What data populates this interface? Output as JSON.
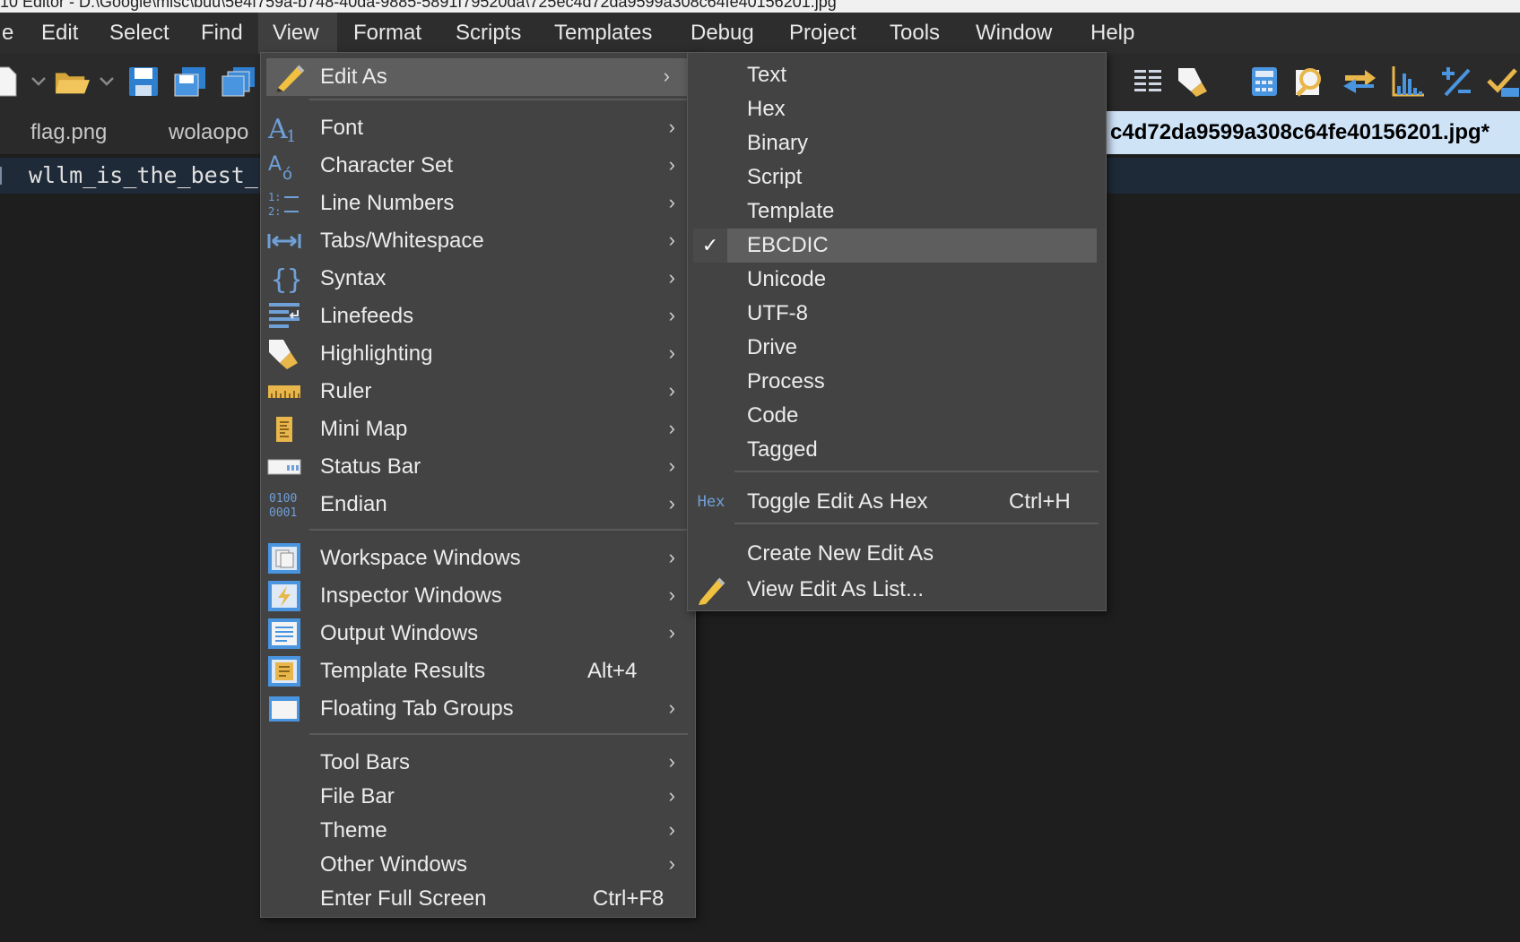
{
  "titlebar": {
    "text": "10 Editor - D:\\Google\\misc\\buu\\5e4f759a-b748-40da-9885-5891f79520da\\725ec4d72da9599a308c64fe40156201.jpg"
  },
  "menubar": {
    "items": [
      "e",
      "Edit",
      "Select",
      "Find",
      "View",
      "Format",
      "Scripts",
      "Templates",
      "Debug",
      "Project",
      "Tools",
      "Window",
      "Help"
    ]
  },
  "file_tabs": {
    "tab1": "flag.png",
    "tab2": "wolaopo",
    "active": "c4d72da9599a308c64fe40156201.jpg*"
  },
  "editor": {
    "line1": "wllm_is_the_best_"
  },
  "view_menu": {
    "edit_as": "Edit As",
    "font": "Font",
    "character_set": "Character Set",
    "line_numbers": "Line Numbers",
    "tabs_whitespace": "Tabs/Whitespace",
    "syntax": "Syntax",
    "linefeeds": "Linefeeds",
    "highlighting": "Highlighting",
    "ruler": "Ruler",
    "mini_map": "Mini Map",
    "status_bar": "Status Bar",
    "endian": "Endian",
    "workspace_windows": "Workspace Windows",
    "inspector_windows": "Inspector Windows",
    "output_windows": "Output Windows",
    "template_results": "Template Results",
    "template_results_shortcut": "Alt+4",
    "floating_tab_groups": "Floating Tab Groups",
    "tool_bars": "Tool Bars",
    "file_bar": "File Bar",
    "theme": "Theme",
    "other_windows": "Other Windows",
    "enter_full_screen": "Enter Full Screen",
    "enter_full_screen_shortcut": "Ctrl+F8",
    "arrow": "›"
  },
  "edit_as_menu": {
    "text": "Text",
    "hex": "Hex",
    "binary": "Binary",
    "script": "Script",
    "template": "Template",
    "ebcdic": "EBCDIC",
    "unicode": "Unicode",
    "utf8": "UTF-8",
    "drive": "Drive",
    "process": "Process",
    "code": "Code",
    "tagged": "Tagged",
    "toggle_hex": "Toggle Edit As Hex",
    "toggle_hex_shortcut": "Ctrl+H",
    "toggle_hex_icon_text": "Hex",
    "create_new": "Create New Edit As",
    "view_list": "View Edit As List...",
    "check": "✓"
  }
}
